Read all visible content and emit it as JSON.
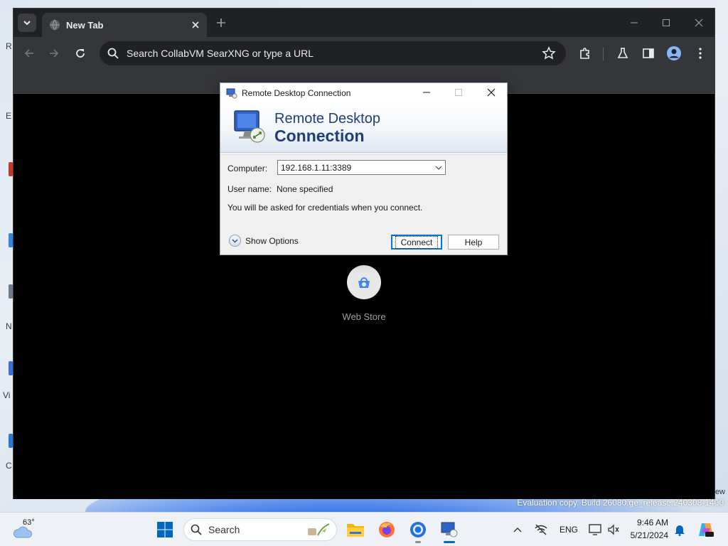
{
  "desktop": {
    "watermark": "Evaluation copy. Build 26080.ge_release.240308-1400",
    "watermark_tail": "ew",
    "sliver_labels": [
      "R",
      "E",
      "N",
      "Vi",
      "C"
    ]
  },
  "browser": {
    "tab_title": "New Tab",
    "omnibox_placeholder": "Search CollabVM SearXNG or type a URL",
    "shortcut_label": "Web Store"
  },
  "dialog": {
    "title": "Remote Desktop Connection",
    "banner_line1": "Remote Desktop",
    "banner_line2": "Connection",
    "computer_label": "Computer:",
    "computer_value": "192.168.1.11:3389",
    "username_label": "User name:",
    "username_value": "None specified",
    "credentials_note": "You will be asked for credentials when you connect.",
    "show_options": "Show Options",
    "connect_button": "Connect",
    "help_button": "Help"
  },
  "taskbar": {
    "weather_temp": "63°",
    "search_placeholder": "Search",
    "language": "ENG",
    "time": "9:46 AM",
    "date": "5/21/2024"
  },
  "colors": {
    "browser_frame": "#202124",
    "browser_toolbar": "#35363a",
    "dialog_banner_text": "#1f3f7a",
    "taskbar_accent": "#0067c0"
  }
}
